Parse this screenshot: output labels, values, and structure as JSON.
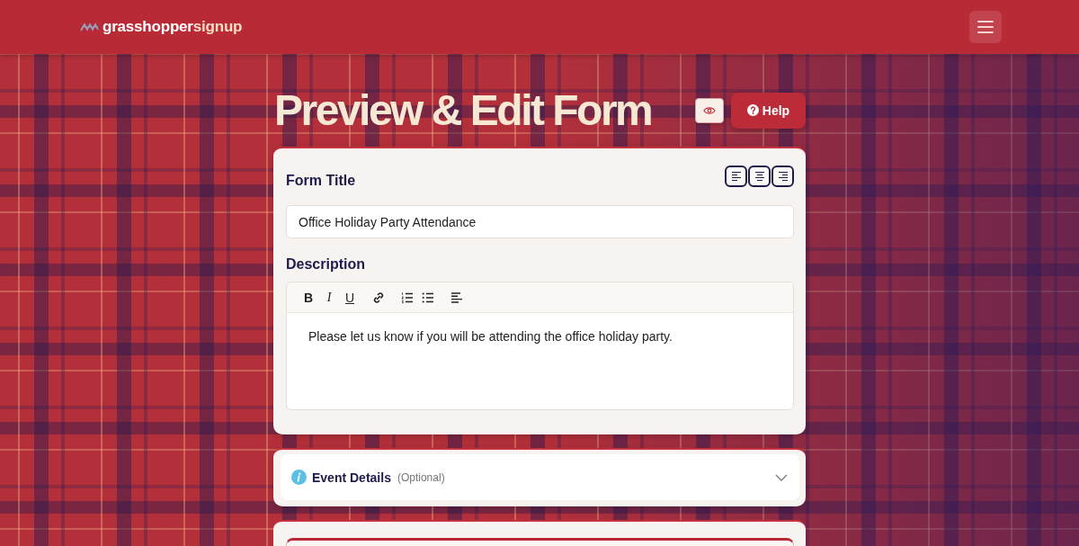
{
  "header": {
    "brand": {
      "start": "grasshopper",
      "end": "signup"
    }
  },
  "page": {
    "title": "Preview & Edit Form",
    "help_label": "Help"
  },
  "form_title": {
    "label": "Form Title",
    "value": "Office Holiday Party Attendance",
    "align_buttons": [
      {
        "kind": "left"
      },
      {
        "kind": "center"
      },
      {
        "kind": "right"
      }
    ]
  },
  "description": {
    "label": "Description",
    "toolbar": [
      [
        {
          "kind": "bold",
          "label": "B"
        },
        {
          "kind": "italic",
          "label": "I"
        },
        {
          "kind": "underline",
          "label": "U"
        }
      ],
      [
        {
          "kind": "link"
        }
      ],
      [
        {
          "kind": "ordered-list"
        },
        {
          "kind": "bullet-list"
        }
      ],
      [
        {
          "kind": "align"
        }
      ]
    ],
    "content": "Please let us know if you will be attending the office holiday party."
  },
  "sections": [
    {
      "title": "Event Details",
      "note": "(Optional)",
      "expanded": false
    }
  ]
}
